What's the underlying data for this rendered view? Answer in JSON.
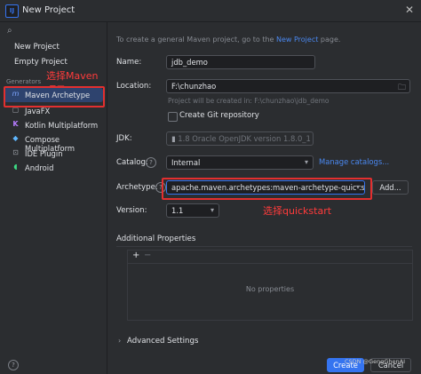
{
  "window": {
    "title": "New Project",
    "app_icon": "intellij-icon",
    "close_icon": "close-icon"
  },
  "sidebar": {
    "search_icon": "search-icon",
    "top_items": [
      "New Project",
      "Empty Project"
    ],
    "generators_heading": "Generators",
    "generators": [
      {
        "label": "Maven Archetype",
        "icon": "maven-icon",
        "glyph": "m"
      },
      {
        "label": "JavaFX",
        "icon": "javafx-icon",
        "glyph": "▢"
      },
      {
        "label": "Kotlin Multiplatform",
        "icon": "kotlin-icon",
        "glyph": "K"
      },
      {
        "label": "Compose Multiplatform",
        "icon": "compose-icon",
        "glyph": "◆"
      },
      {
        "label": "IDE Plugin",
        "icon": "plugin-icon",
        "glyph": "⊡"
      },
      {
        "label": "Android",
        "icon": "android-icon",
        "glyph": "◖"
      }
    ],
    "selected": "Maven Archetype"
  },
  "annotations": {
    "maven": "选择Maven项目",
    "quickstart": "选择quickstart",
    "color": "#e32f2f"
  },
  "main": {
    "hint_prefix": "To create a general Maven project, go to the ",
    "hint_link": "New Project",
    "hint_suffix": " page.",
    "name_label": "Name:",
    "name_value": "jdb_demo",
    "location_label": "Location:",
    "location_value": "F:\\chunzhao",
    "location_hint": "Project will be created in: F:\\chunzhao\\jdb_demo",
    "git_label": "Create Git repository",
    "jdk_label": "JDK:",
    "jdk_version": "1.8",
    "jdk_value": "Oracle OpenJDK version 1.8.0_1",
    "catalog_label": "Catalog:",
    "catalog_value": "Internal",
    "manage_catalogs": "Manage catalogs...",
    "archetype_label": "Archetype:",
    "archetype_value": "apache.maven.archetypes:maven-archetype-quickstart",
    "add_button": "Add...",
    "version_label": "Version:",
    "version_value": "1.1",
    "additional_properties": "Additional Properties",
    "plus": "+",
    "minus": "−",
    "no_properties": "No properties",
    "advanced_settings": "Advanced Settings",
    "create_button": "Create",
    "cancel_button": "Cancel"
  },
  "watermark": "CSDN @GengGhenAI",
  "colors": {
    "accent": "#3574f0",
    "link": "#4a88f0",
    "background": "#2b2d30"
  }
}
